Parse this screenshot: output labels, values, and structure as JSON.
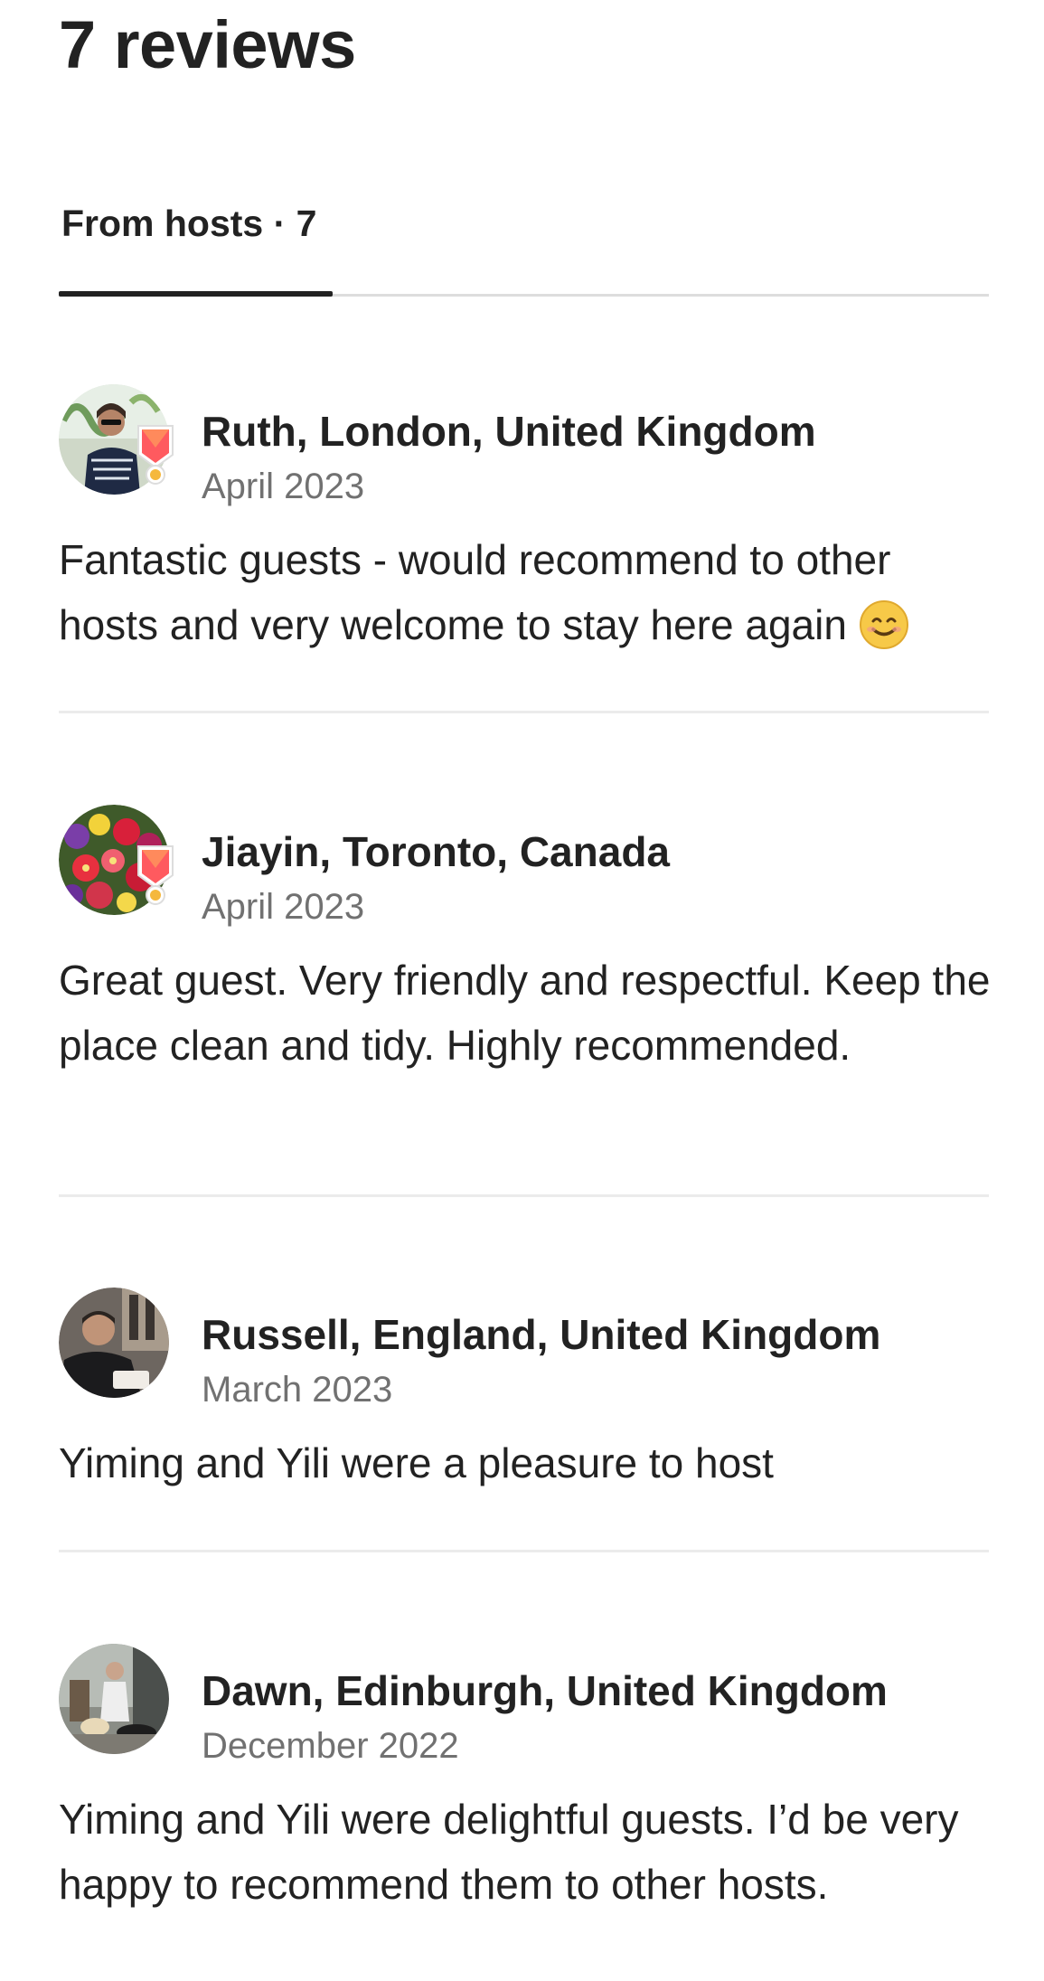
{
  "page": {
    "title": "7 reviews"
  },
  "tabs": [
    {
      "label": "From hosts · 7",
      "selected": true
    }
  ],
  "reviews": [
    {
      "name": "Ruth, London, United Kingdom",
      "date": "April 2023",
      "text": "Fantastic guests - would recommend to other hosts and very welcome to stay here again",
      "emoji": "smiling-face-icon",
      "superhost": true
    },
    {
      "name": "Jiayin, Toronto, Canada",
      "date": "April 2023",
      "text": "Great guest. Very friendly and respectful. Keep the place clean and tidy. Highly recommended.",
      "superhost": true
    },
    {
      "name": "Russell, England, United Kingdom",
      "date": "March 2023",
      "text": "Yiming and Yili were a pleasure to host",
      "superhost": false
    },
    {
      "name": "Dawn, Edinburgh, United Kingdom",
      "date": "December 2022",
      "text": "Yiming and Yili were delightful guests. I’d be very happy to recommend them to other hosts.",
      "superhost": false
    }
  ],
  "colors": {
    "text_primary": "#222222",
    "text_secondary": "#717171",
    "divider": "#ebebeb",
    "superhost_badge": "#ff5a5f"
  }
}
